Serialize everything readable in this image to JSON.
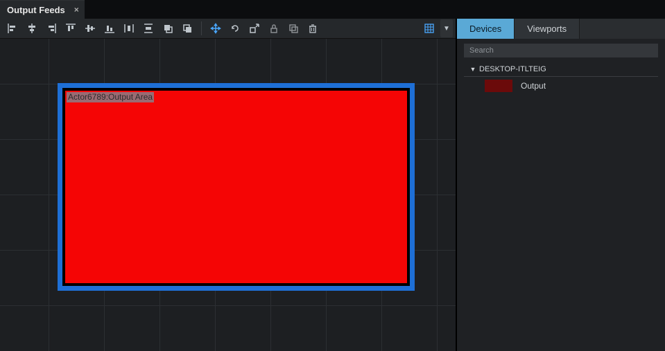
{
  "tab": {
    "title": "Output Feeds"
  },
  "toolbar": {
    "icons": [
      "align-left",
      "align-center-h",
      "align-right",
      "align-top",
      "align-middle-v",
      "align-bottom",
      "distribute-h",
      "distribute-v",
      "bring-front",
      "send-back"
    ]
  },
  "canvas": {
    "node_label": "Actor6789:Output Area"
  },
  "right": {
    "tabs": {
      "devices": "Devices",
      "viewports": "Viewports",
      "active": "devices"
    },
    "search_placeholder": "Search",
    "section_title": "DESKTOP-ITLTEIG",
    "items": [
      {
        "label": "Output",
        "swatch": "#6b0a0a"
      }
    ]
  }
}
